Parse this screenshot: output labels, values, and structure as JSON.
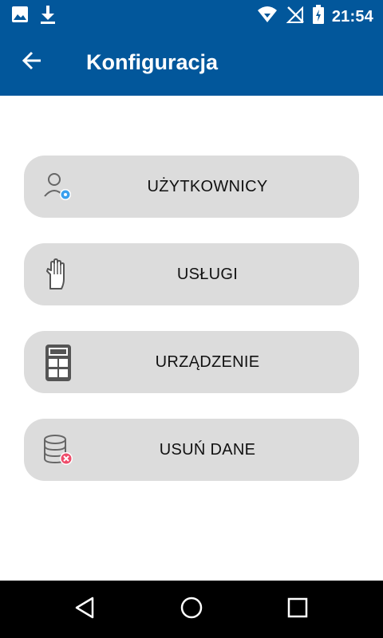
{
  "status_bar": {
    "time": "21:54",
    "icons": [
      "image-icon",
      "download-icon",
      "wifi-icon",
      "no-signal-icon",
      "battery-charging-icon"
    ]
  },
  "app_bar": {
    "back_icon": "arrow-back-icon",
    "title": "Konfiguracja",
    "background_color": "#02579b"
  },
  "menu": {
    "items": [
      {
        "label": "UŻYTKOWNICY",
        "icon": "user-settings-icon"
      },
      {
        "label": "USŁUGI",
        "icon": "hand-icon"
      },
      {
        "label": "URZĄDZENIE",
        "icon": "terminal-device-icon"
      },
      {
        "label": "USUŃ DANE",
        "icon": "delete-data-icon"
      }
    ]
  },
  "nav_bar": {
    "icons": [
      "nav-back-icon",
      "nav-home-icon",
      "nav-recents-icon"
    ]
  }
}
